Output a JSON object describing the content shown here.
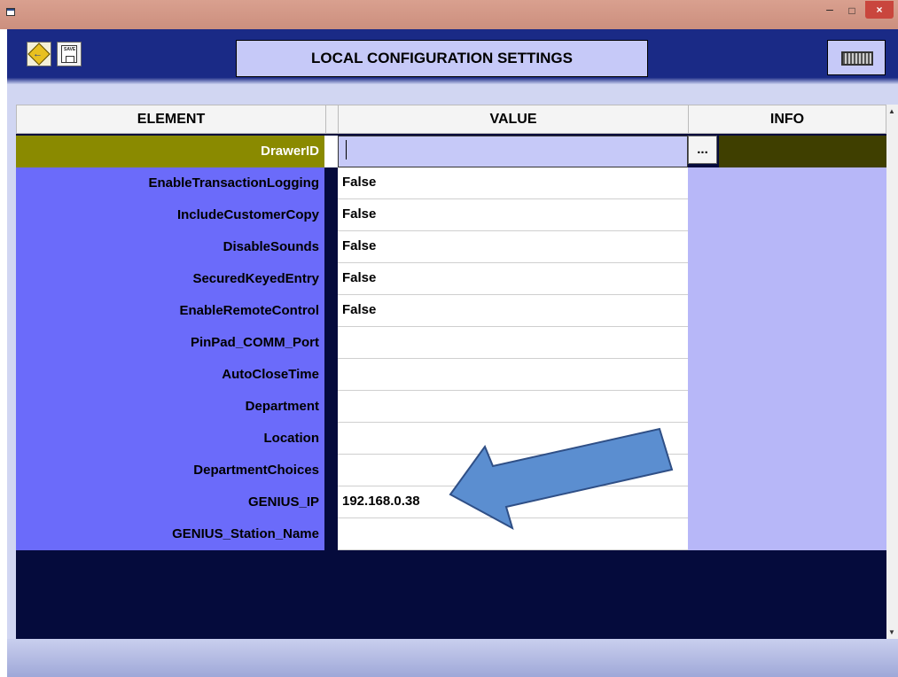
{
  "window": {
    "minimize_glyph": "–",
    "maximize_glyph": "□",
    "close_glyph": "×"
  },
  "toolbar": {
    "exit_icon": "exit-sign-icon",
    "exit_label": "EXIT",
    "save_icon": "floppy-disk-icon",
    "save_label": "SAVE",
    "keyboard_icon": "keyboard-icon",
    "title": "LOCAL CONFIGURATION SETTINGS"
  },
  "grid": {
    "columns": [
      "ELEMENT",
      "VALUE",
      "INFO"
    ],
    "ellipsis_label": "...",
    "rows": [
      {
        "element": "DrawerID",
        "value": ""
      },
      {
        "element": "EnableTransactionLogging",
        "value": "False"
      },
      {
        "element": "IncludeCustomerCopy",
        "value": "False"
      },
      {
        "element": "DisableSounds",
        "value": "False"
      },
      {
        "element": "SecuredKeyedEntry",
        "value": "False"
      },
      {
        "element": "EnableRemoteControl",
        "value": "False"
      },
      {
        "element": "PinPad_COMM_Port",
        "value": ""
      },
      {
        "element": "AutoCloseTime",
        "value": ""
      },
      {
        "element": "Department",
        "value": ""
      },
      {
        "element": "Location",
        "value": ""
      },
      {
        "element": "DepartmentChoices",
        "value": ""
      },
      {
        "element": "GENIUS_IP",
        "value": "192.168.0.38"
      },
      {
        "element": "GENIUS_Station_Name",
        "value": ""
      }
    ]
  },
  "colors": {
    "toolbar_bg": "#1a2a86",
    "element_bg": "#6b6bfa",
    "selected_element_bg": "#8a8a00",
    "info_bg": "#b7b7f8",
    "arrow_fill": "#5b8ed0"
  }
}
